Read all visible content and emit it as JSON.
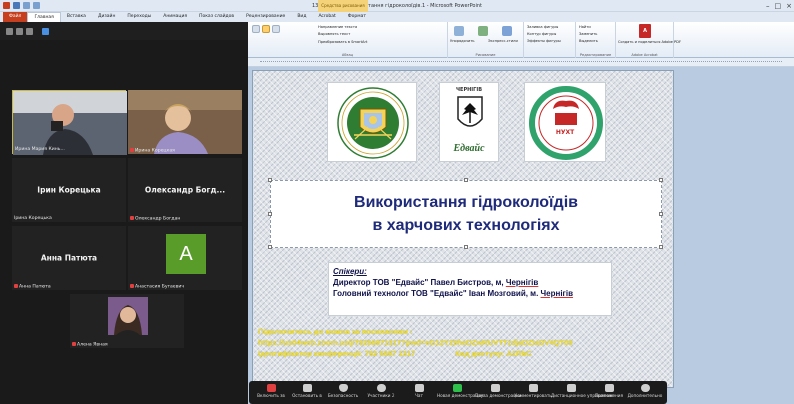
{
  "app": {
    "window_title": "13 Готовое - Використання гідроколоїдів.1 - Microsoft PowerPoint",
    "context_tab": "Средства рисования"
  },
  "ppt_tabs": [
    "Файл",
    "Главная",
    "Вставка",
    "Дизайн",
    "Переходы",
    "Анимация",
    "Показ слайдов",
    "Рецензирование",
    "Вид",
    "Acrobat",
    "Формат"
  ],
  "ribbon": {
    "groups": [
      {
        "label": "Абзац",
        "items": [
          "Направление текста",
          "Выровнять текст",
          "Преобразовать в SmartArt"
        ]
      },
      {
        "label": "Рисование",
        "items": [
          "Упорядочить",
          "Экспресс-стили"
        ]
      },
      {
        "label": "",
        "items": [
          "Заливка фигуры",
          "Контур фигуры",
          "Эффекты фигуры"
        ]
      },
      {
        "label": "Редактирование",
        "items": [
          "Найти",
          "Заменить",
          "Выделить"
        ]
      },
      {
        "label": "Adobe Acrobat",
        "items": [
          "Создать и поделиться Adobe PDF"
        ]
      }
    ]
  },
  "slide": {
    "logos": [
      {
        "name": "Факультет готельно-ресторанного та туристичного бізнесу"
      },
      {
        "name": "Чернігів Едвайс",
        "top_text": "ЧЕРНІГІВ",
        "bottom_text": "Едвайс"
      },
      {
        "name": "НУХТ",
        "text": "НУХТ"
      }
    ],
    "title_line1": "Використання гідроколоїдів",
    "title_line2": "в харчових технологіях",
    "speakers_header": "Спікери:",
    "speaker1_a": "Директор ТОВ  \"Едвайс\" Павел Бистров, м, ",
    "speaker1_city": "Чернігів",
    "speaker2_a": "Головний технолог ТОВ \"Едвайс\" Іван Мозговий, м. ",
    "speaker2_city": "Чернігів",
    "join_line1": "Підключитись до можна за посиланням :",
    "join_line2": "https://us04web.zoom.us/j/79266971317?pwd=eG12Y29heDZwRUVTTzdjaDZIaDV4QT09",
    "join_line3": "Ідентифікатор конференції: 792 6697 1317",
    "join_line3b": "Код доступу: A1RbC"
  },
  "zoom": {
    "participants": [
      {
        "caption": "Ирина Мария Кинь..."
      },
      {
        "caption": "Ирина Корецкая"
      },
      {
        "caption": "Ірина Корецька",
        "center_name": "Ірин  Корецька"
      },
      {
        "caption": "Олександр Богдан",
        "center_name": "Олександр  Богд..."
      },
      {
        "caption": "Анна Патюта",
        "center_name": "Анна Патюта"
      },
      {
        "caption": "Анастасия Бугаевич",
        "avatar_letter": "A"
      },
      {
        "caption": "Алена Явная"
      }
    ],
    "controls": [
      "Включить зв",
      "Остановить в",
      "Безопасность",
      "Участники",
      "Чат",
      "Новая демонстрация",
      "Пауза демонстрации",
      "Комментировать",
      "Дистанционное управление",
      "Приложения",
      "Дополнительно"
    ],
    "participant_count": "2",
    "colors": {
      "share_green": "#2fbf4b",
      "avatar_green": "#5a9c2a"
    }
  }
}
